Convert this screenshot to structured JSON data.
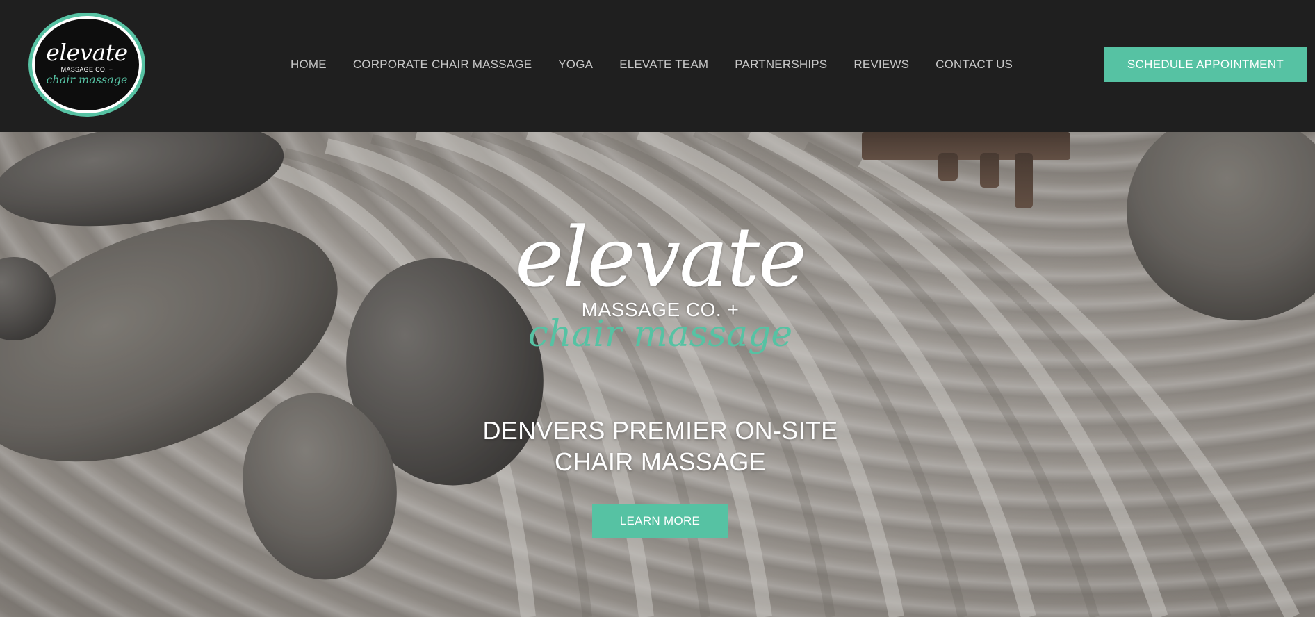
{
  "header": {
    "logo": {
      "word": "elevate",
      "sub": "MASSAGE CO. +",
      "script": "chair massage"
    },
    "nav": {
      "items": [
        {
          "label": "HOME"
        },
        {
          "label": "CORPORATE CHAIR MASSAGE"
        },
        {
          "label": "YOGA"
        },
        {
          "label": "ELEVATE TEAM"
        },
        {
          "label": "PARTNERSHIPS"
        },
        {
          "label": "REVIEWS"
        },
        {
          "label": "CONTACT US"
        }
      ]
    },
    "cta_label": "SCHEDULE APPOINTMENT"
  },
  "hero": {
    "logo": {
      "word": "elevate",
      "sub": "MASSAGE CO. +",
      "script": "chair massage"
    },
    "tagline_line1": "DENVERS PREMIER ON-SITE",
    "tagline_line2": "CHAIR MASSAGE",
    "button_label": "LEARN MORE"
  },
  "colors": {
    "header_bg": "#1f1f1f",
    "accent": "#56c2a3",
    "nav_text": "#c8c8c8",
    "white": "#ffffff"
  }
}
